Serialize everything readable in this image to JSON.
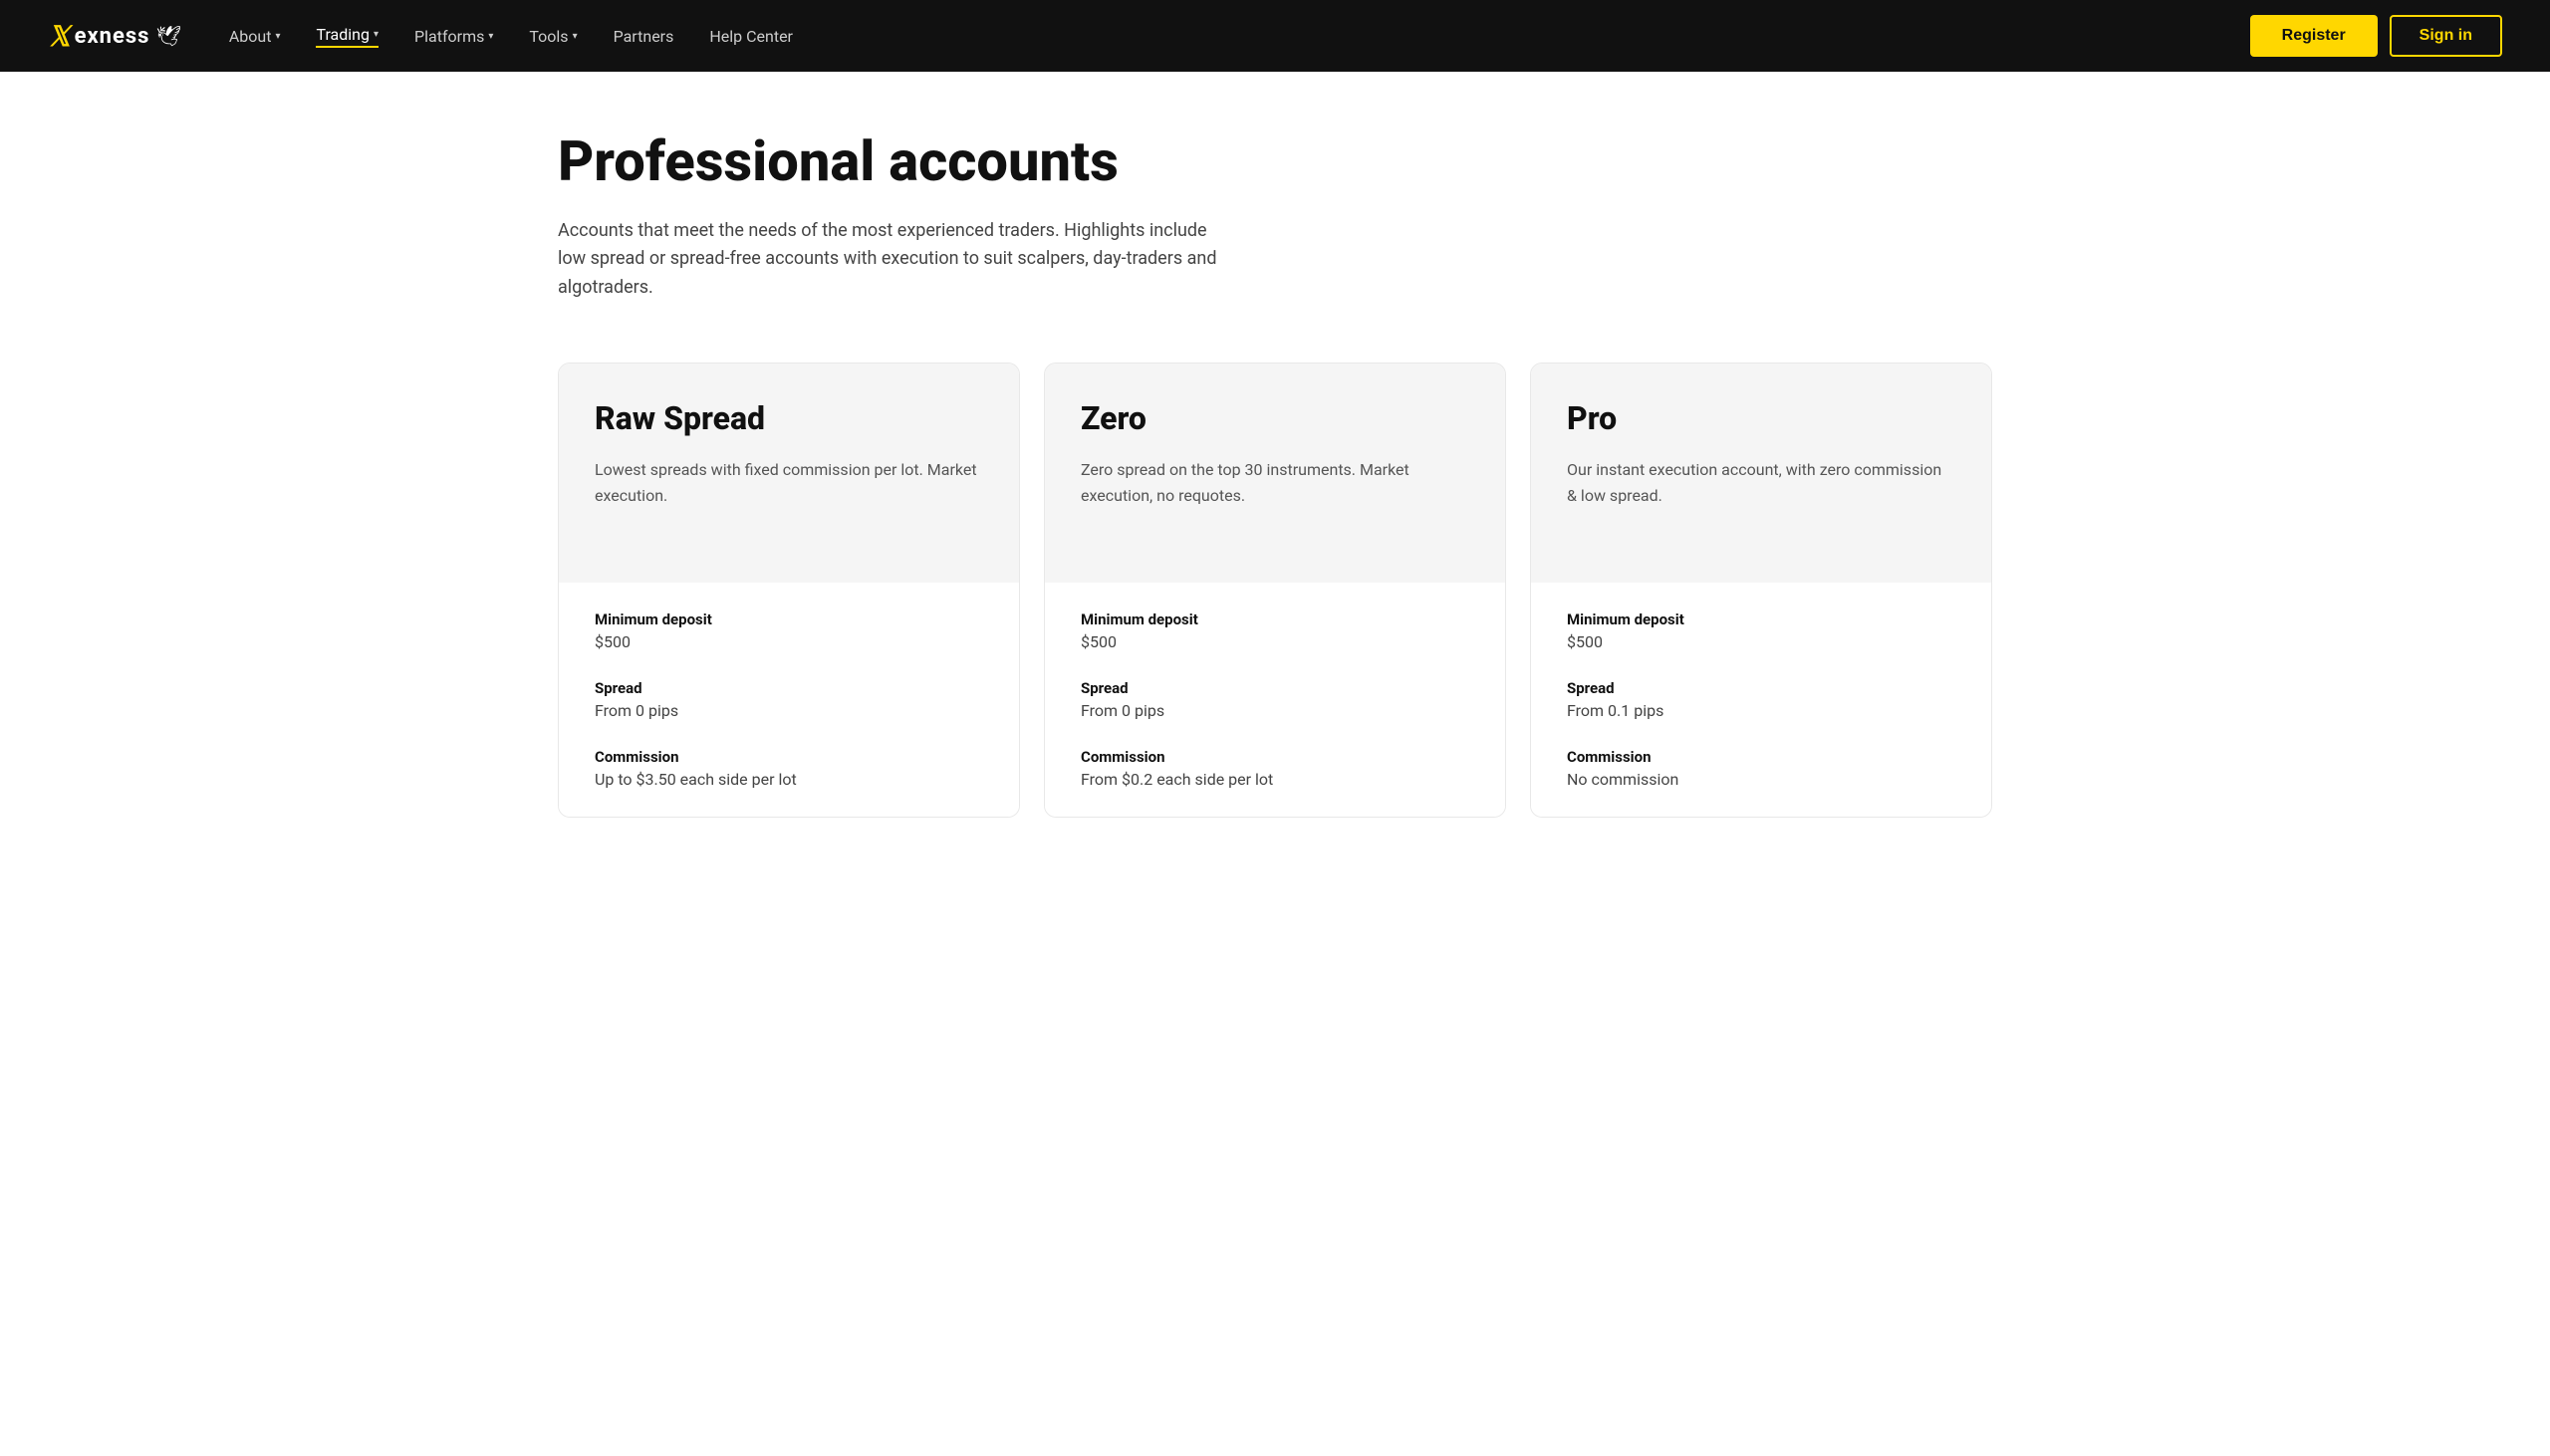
{
  "brand": {
    "logo_text": "exness",
    "logo_symbol": "𝕏",
    "bird_emoji": "🕊"
  },
  "navbar": {
    "links": [
      {
        "label": "About",
        "has_dropdown": true,
        "active": false
      },
      {
        "label": "Trading",
        "has_dropdown": true,
        "active": true
      },
      {
        "label": "Platforms",
        "has_dropdown": true,
        "active": false
      },
      {
        "label": "Tools",
        "has_dropdown": true,
        "active": false
      },
      {
        "label": "Partners",
        "has_dropdown": false,
        "active": false
      },
      {
        "label": "Help Center",
        "has_dropdown": false,
        "active": false
      }
    ],
    "register_label": "Register",
    "signin_label": "Sign in"
  },
  "page": {
    "title": "Professional accounts",
    "description": "Accounts that meet the needs of the most experienced traders. Highlights include low spread or spread-free accounts with execution to suit scalpers, day-traders and algotraders."
  },
  "accounts": [
    {
      "name": "Raw Spread",
      "description": "Lowest spreads with fixed commission per lot. Market execution.",
      "minimum_deposit_label": "Minimum deposit",
      "minimum_deposit_value": "$500",
      "spread_label": "Spread",
      "spread_value": "From 0 pips",
      "commission_label": "Commission",
      "commission_value": "Up to $3.50 each side per lot"
    },
    {
      "name": "Zero",
      "description": "Zero spread on the top 30 instruments. Market execution, no requotes.",
      "minimum_deposit_label": "Minimum deposit",
      "minimum_deposit_value": "$500",
      "spread_label": "Spread",
      "spread_value": "From 0 pips",
      "commission_label": "Commission",
      "commission_value": "From $0.2 each side per lot"
    },
    {
      "name": "Pro",
      "description": "Our instant execution account, with zero commission & low spread.",
      "minimum_deposit_label": "Minimum deposit",
      "minimum_deposit_value": "$500",
      "spread_label": "Spread",
      "spread_value": "From 0.1 pips",
      "commission_label": "Commission",
      "commission_value": "No commission"
    }
  ]
}
